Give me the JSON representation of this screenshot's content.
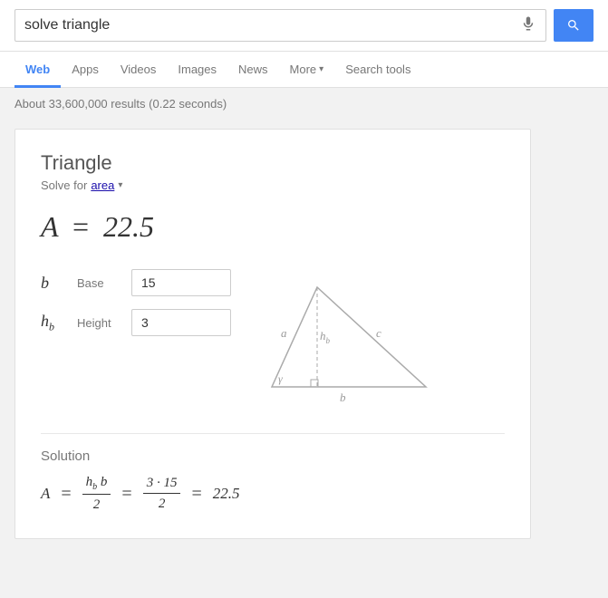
{
  "search": {
    "query": "solve triangle",
    "placeholder": "solve triangle",
    "mic_label": "Voice search",
    "button_label": "Search"
  },
  "nav": {
    "tabs": [
      {
        "id": "web",
        "label": "Web",
        "active": true
      },
      {
        "id": "apps",
        "label": "Apps",
        "active": false
      },
      {
        "id": "videos",
        "label": "Videos",
        "active": false
      },
      {
        "id": "images",
        "label": "Images",
        "active": false
      },
      {
        "id": "news",
        "label": "News",
        "active": false
      },
      {
        "id": "more",
        "label": "More",
        "active": false,
        "has_arrow": true
      },
      {
        "id": "search-tools",
        "label": "Search tools",
        "active": false
      }
    ]
  },
  "results": {
    "count_text": "About 33,600,000 results (0.22 seconds)"
  },
  "calculator": {
    "title": "Triangle",
    "solve_for_label": "Solve for",
    "solve_for_value": "area",
    "result_var": "A",
    "result_equals": "=",
    "result_value": "22.5",
    "inputs": [
      {
        "var": "b",
        "sub": "",
        "name": "Base",
        "value": "15"
      },
      {
        "var": "h",
        "sub": "b",
        "name": "Height",
        "value": "3"
      }
    ],
    "solution": {
      "title": "Solution",
      "formula_text": "A = (h_b · b) / 2 = (3 · 15) / 2 = 22.5",
      "lhs_var": "A",
      "numerator_top": "h",
      "numerator_sub": "b",
      "numerator_rest": "b",
      "denominator": "2",
      "equals1": "=",
      "num2_top": "3 · 15",
      "den2": "2",
      "equals2": "=",
      "final_value": "22.5"
    }
  },
  "colors": {
    "accent": "#4285f4",
    "active_tab": "#4285f4",
    "link": "#1a0dab"
  }
}
